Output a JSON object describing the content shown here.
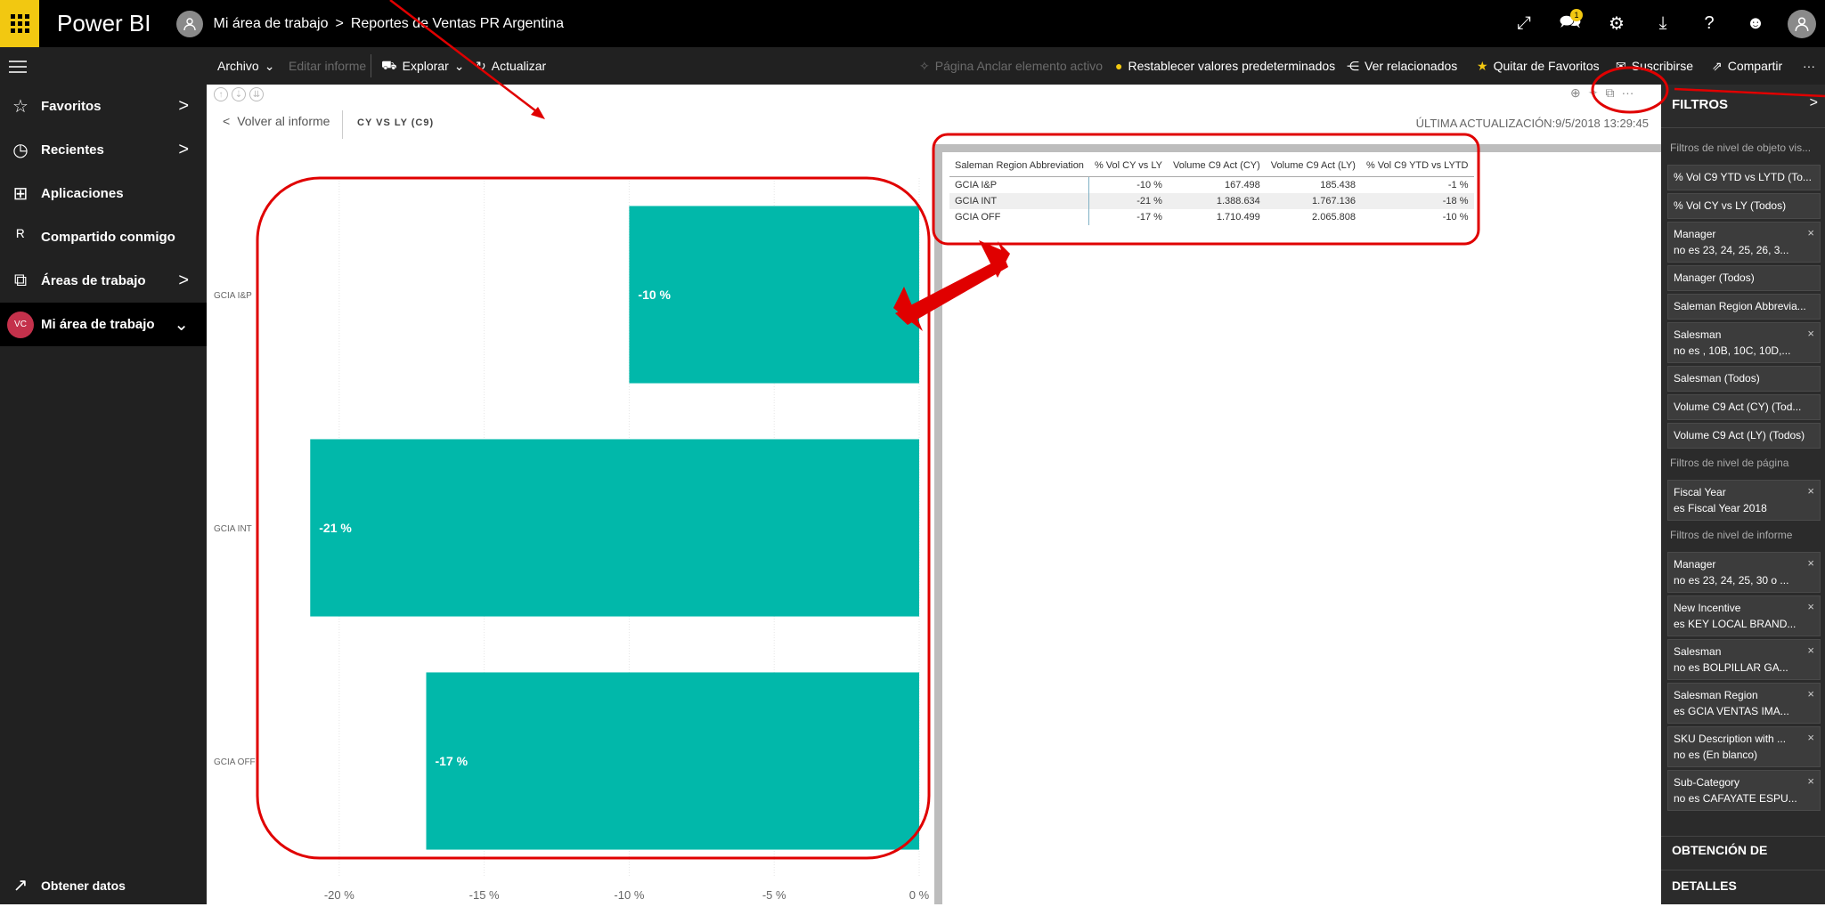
{
  "app": {
    "name": "Power BI"
  },
  "breadcrumb": {
    "workspace": "Mi área de trabajo",
    "report": "Reportes de Ventas PR Argentina"
  },
  "topbar": {
    "notification_count": "1"
  },
  "commands": {
    "archivo": "Archivo",
    "editar": "Editar informe",
    "explorar": "Explorar",
    "actualizar": "Actualizar",
    "pagina": "Página Anclar elemento activo",
    "restablecer": "Restablecer valores predeterminados",
    "ver_relacionados": "Ver relacionados",
    "quitar_favoritos": "Quitar de Favoritos",
    "suscribirse": "Suscribirse",
    "compartir": "Compartir"
  },
  "nav": {
    "items": [
      {
        "label": "Favoritos"
      },
      {
        "label": "Recientes"
      },
      {
        "label": "Aplicaciones"
      },
      {
        "label": "Compartido conmigo"
      },
      {
        "label": "Áreas de trabajo"
      },
      {
        "label": "Mi área de trabajo",
        "initials": "VC"
      }
    ],
    "get_data": "Obtener datos"
  },
  "visual": {
    "back_label": "Volver al informe",
    "title": "CY VS LY (C9)",
    "updated": "ÚLTIMA ACTUALIZACIÓN:9/5/2018 13:29:45"
  },
  "chart_data": {
    "type": "bar",
    "orientation": "horizontal",
    "categories": [
      "GCIA I&P",
      "GCIA INT",
      "GCIA OFF"
    ],
    "values": [
      -10,
      -21,
      -17
    ],
    "labels": [
      "-10 %",
      "-21 %",
      "-17 %"
    ],
    "xlim": [
      -21.5,
      0
    ],
    "xticks": [
      -20,
      -15,
      -10,
      -5,
      0
    ],
    "xtick_labels": [
      "-20 %",
      "-15 %",
      "-10 %",
      "-5 %",
      "0 %"
    ],
    "bar_color": "#01b8aa",
    "grid": true
  },
  "table": {
    "columns": [
      "Saleman Region Abbreviation",
      "% Vol CY vs LY",
      "Volume C9 Act (CY)",
      "Volume C9 Act (LY)",
      "% Vol C9 YTD vs LYTD"
    ],
    "rows": [
      [
        "GCIA I&P",
        "-10 %",
        "167.498",
        "185.438",
        "-1 %"
      ],
      [
        "GCIA INT",
        "-21 %",
        "1.388.634",
        "1.767.136",
        "-18 %"
      ],
      [
        "GCIA OFF",
        "-17 %",
        "1.710.499",
        "2.065.808",
        "-10 %"
      ]
    ]
  },
  "filters": {
    "title": "FILTROS",
    "visual_level": "Filtros de nivel de objeto vis...",
    "visual_cards": [
      {
        "name": "% Vol C9 YTD vs LYTD (To...",
        "value": ""
      },
      {
        "name": "% Vol CY vs LY (Todos)",
        "value": ""
      },
      {
        "name": "Manager",
        "value": "no es 23, 24, 25, 26, 3..."
      },
      {
        "name": "Manager (Todos)",
        "value": ""
      },
      {
        "name": "Saleman Region Abbrevia...",
        "value": ""
      },
      {
        "name": "Salesman",
        "value": "no es , 10B, 10C, 10D,..."
      },
      {
        "name": "Salesman (Todos)",
        "value": ""
      },
      {
        "name": "Volume C9 Act (CY) (Tod...",
        "value": ""
      },
      {
        "name": "Volume C9 Act (LY) (Todos)",
        "value": ""
      }
    ],
    "page_level": "Filtros de nivel de página",
    "page_cards": [
      {
        "name": "Fiscal Year",
        "value": "es Fiscal Year 2018"
      }
    ],
    "report_level": "Filtros de nivel de informe",
    "report_cards": [
      {
        "name": "Manager",
        "value": "no es 23, 24, 25, 30 o ..."
      },
      {
        "name": "New Incentive",
        "value": "es KEY LOCAL BRAND..."
      },
      {
        "name": "Salesman",
        "value": "no es BOLPILLAR GA..."
      },
      {
        "name": "Salesman Region",
        "value": "es GCIA VENTAS IMA..."
      },
      {
        "name": "SKU Description with ...",
        "value": "no es (En blanco)"
      },
      {
        "name": "Sub-Category",
        "value": "no es CAFAYATE ESPU..."
      }
    ],
    "obtencion": "OBTENCIÓN DE",
    "detalles": "DETALLES"
  },
  "colors": {
    "accent": "#f2c811",
    "bar": "#01b8aa",
    "annotation": "#e00000"
  }
}
